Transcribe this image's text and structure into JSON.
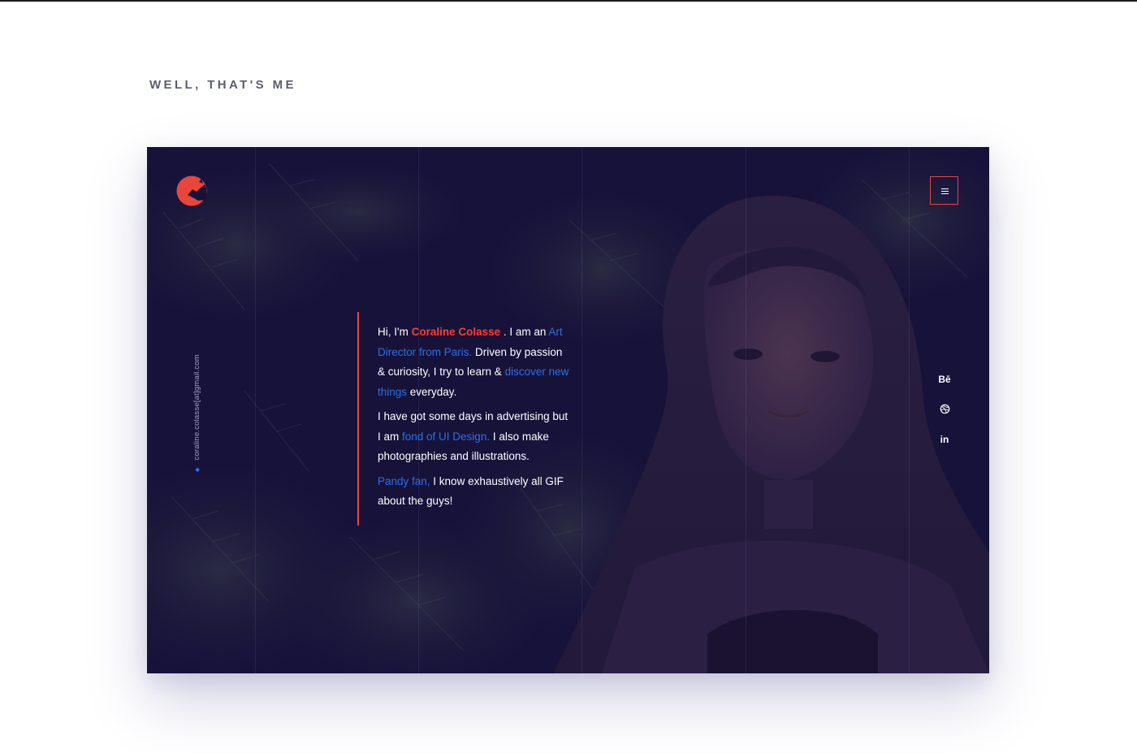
{
  "section": {
    "title": "WELL, THAT'S ME"
  },
  "mockup": {
    "email": "coraline.colasse[at]gmail.com",
    "bio": {
      "p1": {
        "greet": "Hi, I'm ",
        "name": "Coraline Colasse",
        "mid": " . I am an ",
        "role": "Art Director from Paris.",
        "rest": " Driven by passion & curiosity, I try to learn & ",
        "discover": "discover new things",
        "end": " everyday."
      },
      "p2": {
        "start": "I have got some days in advertising but I am ",
        "fond": "fond of UI Design.",
        "end": " I also make photographies and illustrations."
      },
      "p3": {
        "pandy": "Pandy fan,",
        "end": " I know exhaustively all GIF about the guys!"
      }
    },
    "social": {
      "behance": "Bē",
      "linkedin": "in"
    },
    "icons": {
      "logo": "fox-logo-icon",
      "menu": "hamburger-menu-icon",
      "behance": "behance-icon",
      "dribbble": "dribbble-icon",
      "linkedin": "linkedin-icon"
    }
  },
  "colors": {
    "background": "#17123a",
    "accent_red": "#e8463b",
    "accent_blue": "#2c6fe6"
  }
}
